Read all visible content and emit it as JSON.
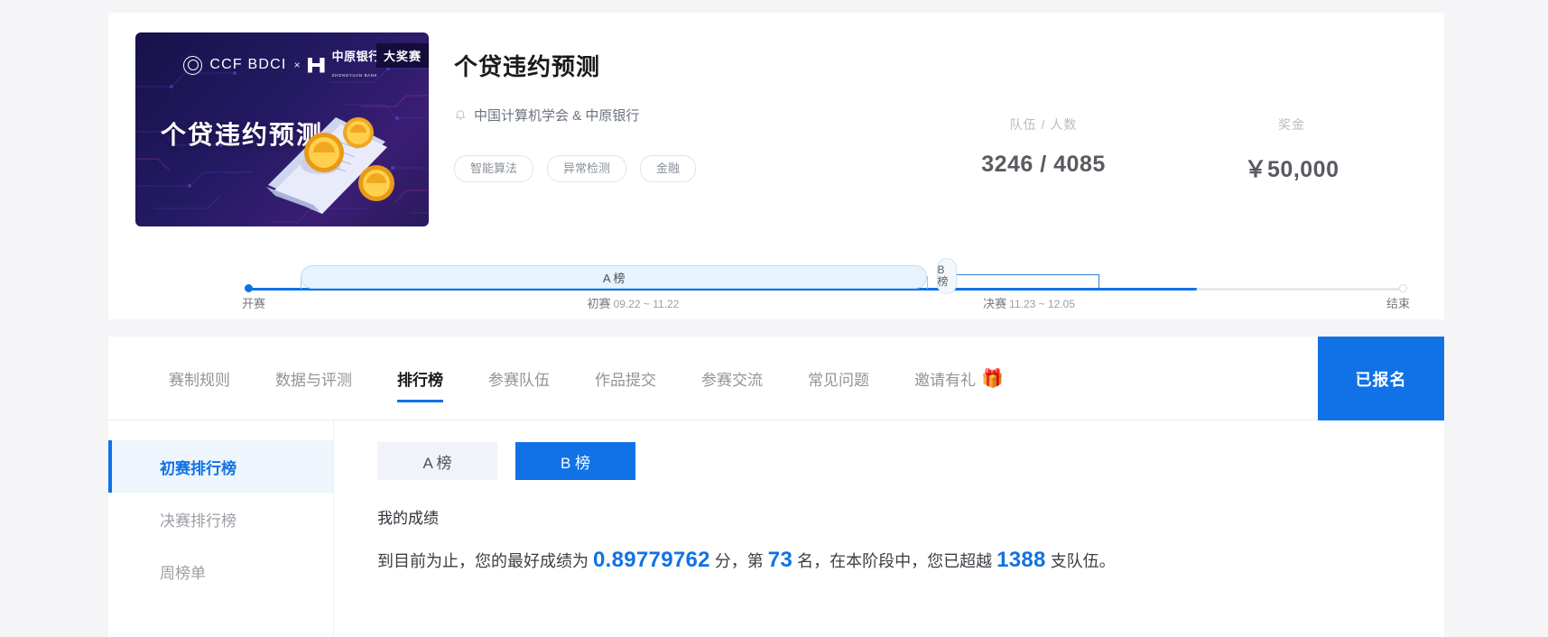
{
  "hero": {
    "banner": {
      "ccf_text": "CCF BDCI",
      "x_separator": "×",
      "bank_cn": "中原银行",
      "bank_en": "ZHONGYUAN BANK",
      "prize_badge": "大奖赛",
      "banner_title": "个贷违约预测"
    },
    "title": "个贷违约预测",
    "organizer": "中国计算机学会 & 中原银行",
    "organizer_icon": "bell-icon",
    "tags": [
      "智能算法",
      "异常检测",
      "金融"
    ],
    "stats": [
      {
        "label": "队伍 / 人数",
        "value": "3246 / 4085"
      },
      {
        "label": "奖金",
        "value": "￥50,000"
      }
    ]
  },
  "timeline": {
    "phase_pills": [
      {
        "label": "A 榜"
      },
      {
        "label": "B 榜"
      }
    ],
    "milestones": [
      {
        "name": "开赛",
        "dates": ""
      },
      {
        "name": "初赛",
        "dates": "09.22 ~ 11.22"
      },
      {
        "name": "决赛",
        "dates": "11.23 ~ 12.05"
      },
      {
        "name": "结束",
        "dates": ""
      }
    ]
  },
  "nav": {
    "tabs": [
      {
        "label": "赛制规则",
        "active": false
      },
      {
        "label": "数据与评测",
        "active": false
      },
      {
        "label": "排行榜",
        "active": true
      },
      {
        "label": "参赛队伍",
        "active": false
      },
      {
        "label": "作品提交",
        "active": false
      },
      {
        "label": "参赛交流",
        "active": false
      },
      {
        "label": "常见问题",
        "active": false
      },
      {
        "label": "邀请有礼",
        "active": false,
        "icon": "gift-icon",
        "emoji": "🎁"
      }
    ],
    "enrolled_button": "已报名"
  },
  "sidebar": {
    "items": [
      {
        "label": "初赛排行榜",
        "active": true
      },
      {
        "label": "决赛排行榜",
        "active": false
      },
      {
        "label": "周榜单",
        "active": false
      }
    ]
  },
  "leaderboard": {
    "segments": [
      {
        "label": "A 榜",
        "active": false
      },
      {
        "label": "B 榜",
        "active": true
      }
    ],
    "my_score_heading": "我的成绩",
    "score_sentence": {
      "prefix": "到目前为止，您的最好成绩为",
      "score": "0.89779762",
      "mid1": "分，第",
      "rank": "73",
      "mid2": "名，在本阶段中，您已超越",
      "surpassed": "1388",
      "suffix": "支队伍。"
    }
  },
  "colors": {
    "accent_blue": "#1072e6",
    "pill_blue_bg": "#e7f3fd",
    "sidebar_active_bg": "#eef5fc",
    "page_bg": "#f5f5f7",
    "muted_text": "#909499"
  }
}
